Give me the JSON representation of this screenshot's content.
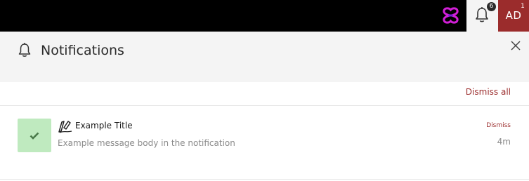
{
  "topbar": {
    "notification_badge": "6",
    "avatar_initials": "AD",
    "avatar_badge": "1",
    "colors": {
      "bar": "#000000",
      "avatar": "#9b2c2c",
      "logo": "#d11fd6"
    }
  },
  "panel": {
    "title": "Notifications",
    "dismiss_all_label": "Dismiss all",
    "close_icon": "close-icon",
    "header_icon": "bell-icon"
  },
  "notifications": [
    {
      "status_icon": "checkmark-icon",
      "status_color": "#bfeabf",
      "type_icon": "signature-pen-icon",
      "title": "Example Title",
      "body": "Example message body in the notification",
      "dismiss_label": "Dismiss",
      "time": "4m"
    }
  ]
}
